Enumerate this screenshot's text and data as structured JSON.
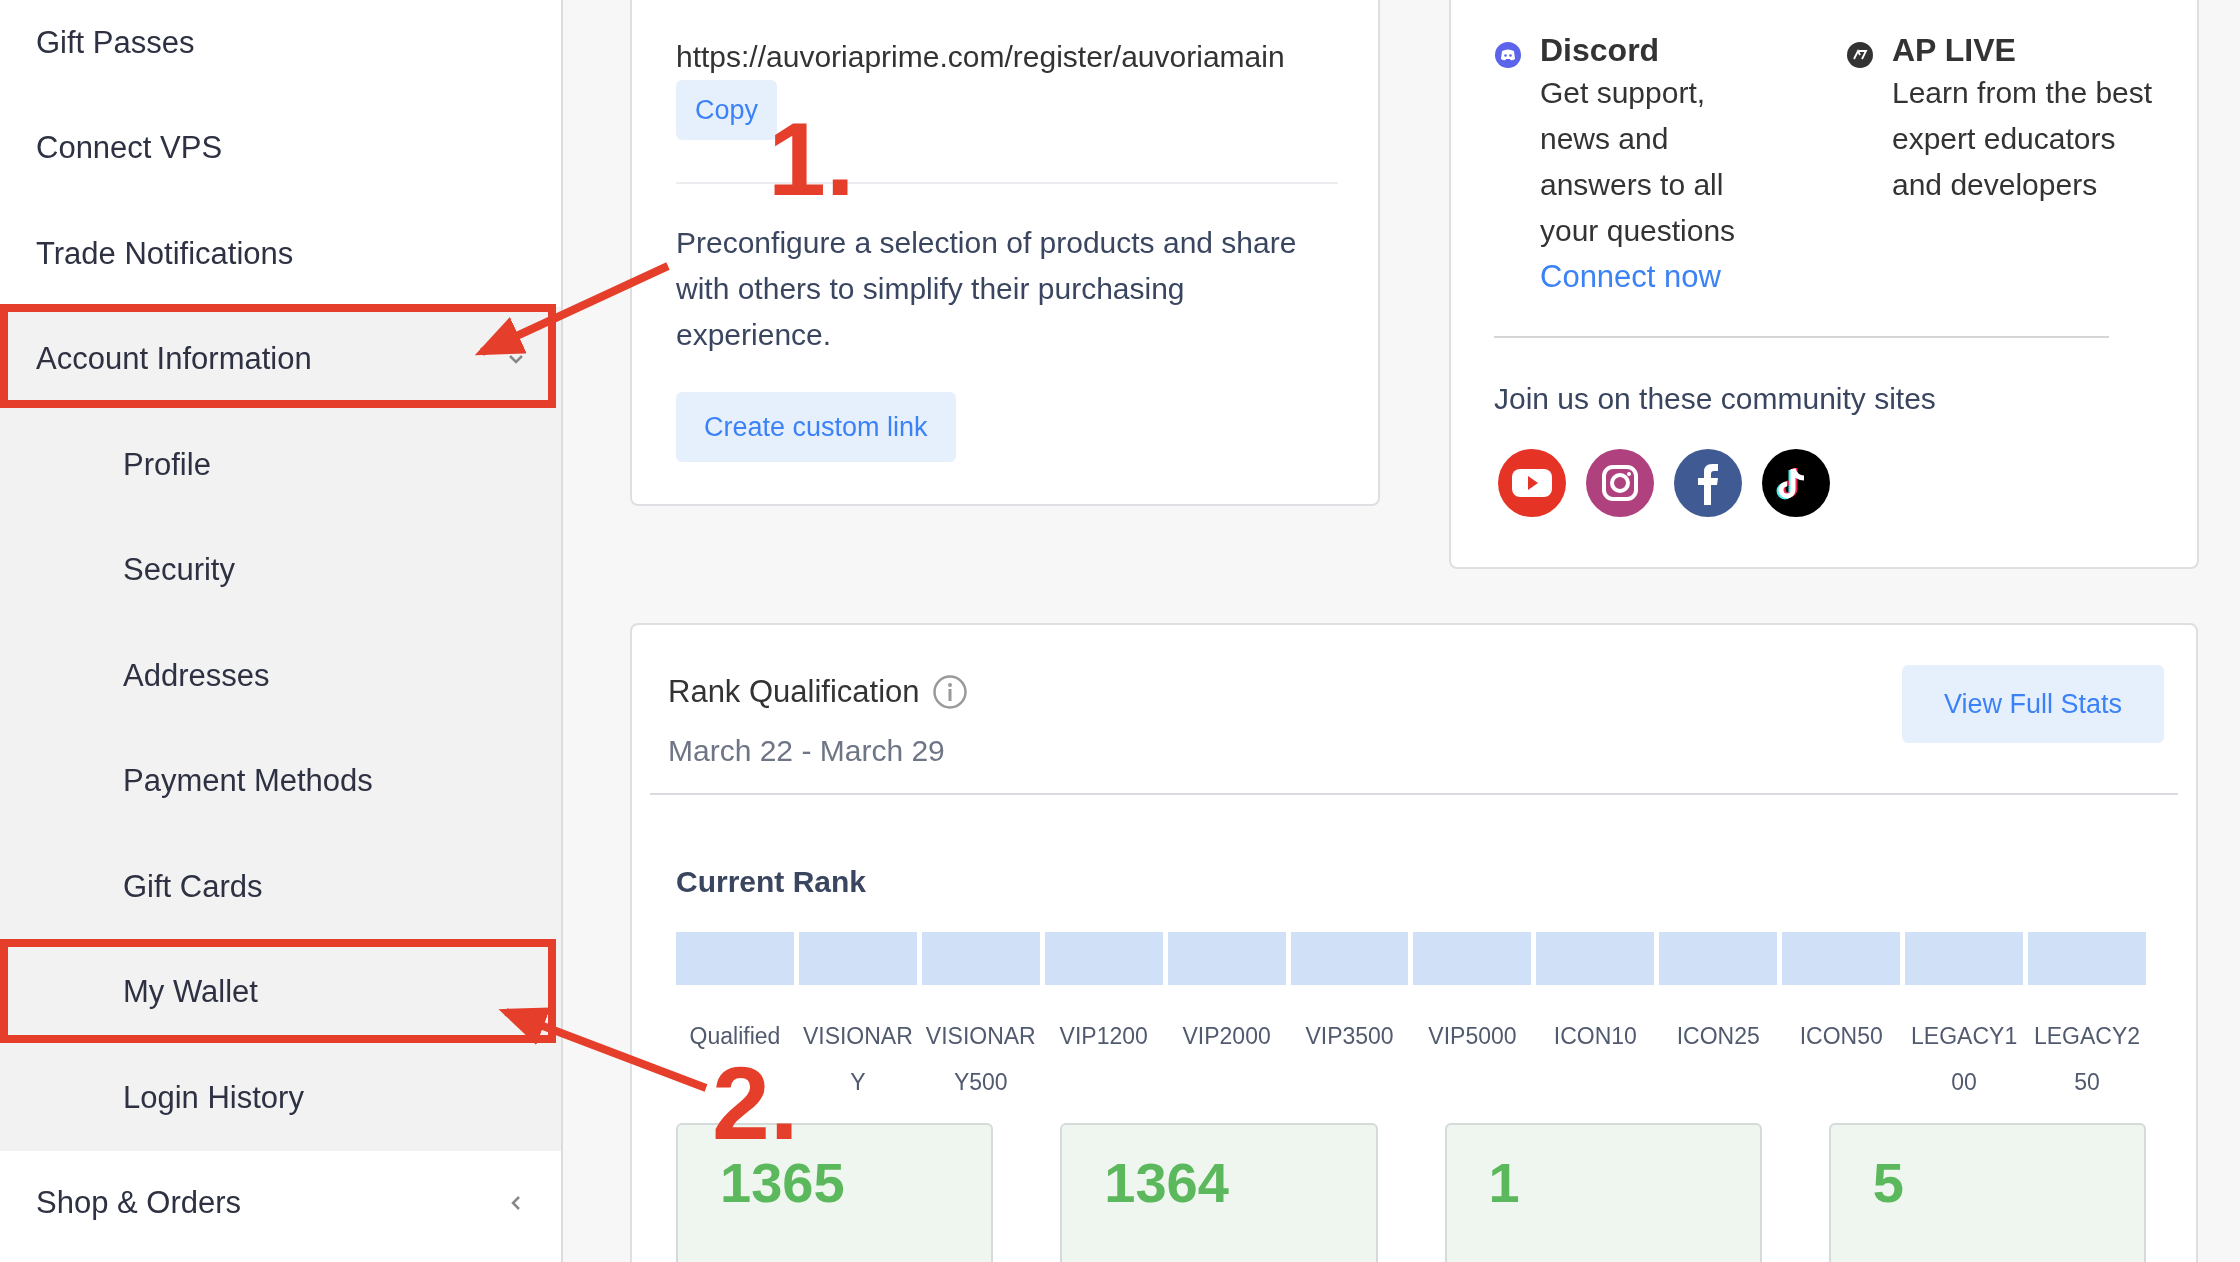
{
  "sidebar": {
    "items": [
      {
        "label": "Gift Passes"
      },
      {
        "label": "Connect VPS"
      },
      {
        "label": "Trade Notifications"
      },
      {
        "label": "Account Information",
        "expanded": true,
        "children": [
          {
            "label": "Profile"
          },
          {
            "label": "Security"
          },
          {
            "label": "Addresses"
          },
          {
            "label": "Payment Methods"
          },
          {
            "label": "Gift Cards"
          },
          {
            "label": "My Wallet"
          },
          {
            "label": "Login History"
          }
        ]
      },
      {
        "label": "Shop & Orders",
        "expanded": false
      }
    ]
  },
  "referral_card": {
    "url": "https://auvoriaprime.com/register/auvoriamain",
    "copy_button": "Copy",
    "description": "Preconfigure a selection of products and share with others to simplify their purchasing experience.",
    "custom_link_button": "Create custom link"
  },
  "community_card": {
    "channels": [
      {
        "kind": "discord",
        "title": "Discord",
        "text": "Get support, news and answers to all your questions",
        "link": "Connect now"
      },
      {
        "kind": "aplive",
        "title": "AP LIVE",
        "text": "Learn from the best expert educators and developers"
      }
    ],
    "join_text": "Join us on these community sites",
    "sites": [
      {
        "kind": "youtube"
      },
      {
        "kind": "instagram"
      },
      {
        "kind": "facebook"
      },
      {
        "kind": "tiktok"
      }
    ]
  },
  "rank_card": {
    "title": "Rank Qualification",
    "date_range": "March 22 - March 29",
    "button": "View Full Stats",
    "current_rank_title": "Current Rank",
    "levels": [
      "Qualified",
      "VISIONARY",
      "VISIONARY500",
      "VIP1200",
      "VIP2000",
      "VIP3500",
      "VIP5000",
      "ICON10",
      "ICON25",
      "ICON50",
      "LEGACY100",
      "LEGACY250"
    ],
    "stats": [
      "1365",
      "1364",
      "1",
      "5"
    ]
  },
  "annotations": [
    {
      "label": "1."
    },
    {
      "label": "2."
    }
  ]
}
